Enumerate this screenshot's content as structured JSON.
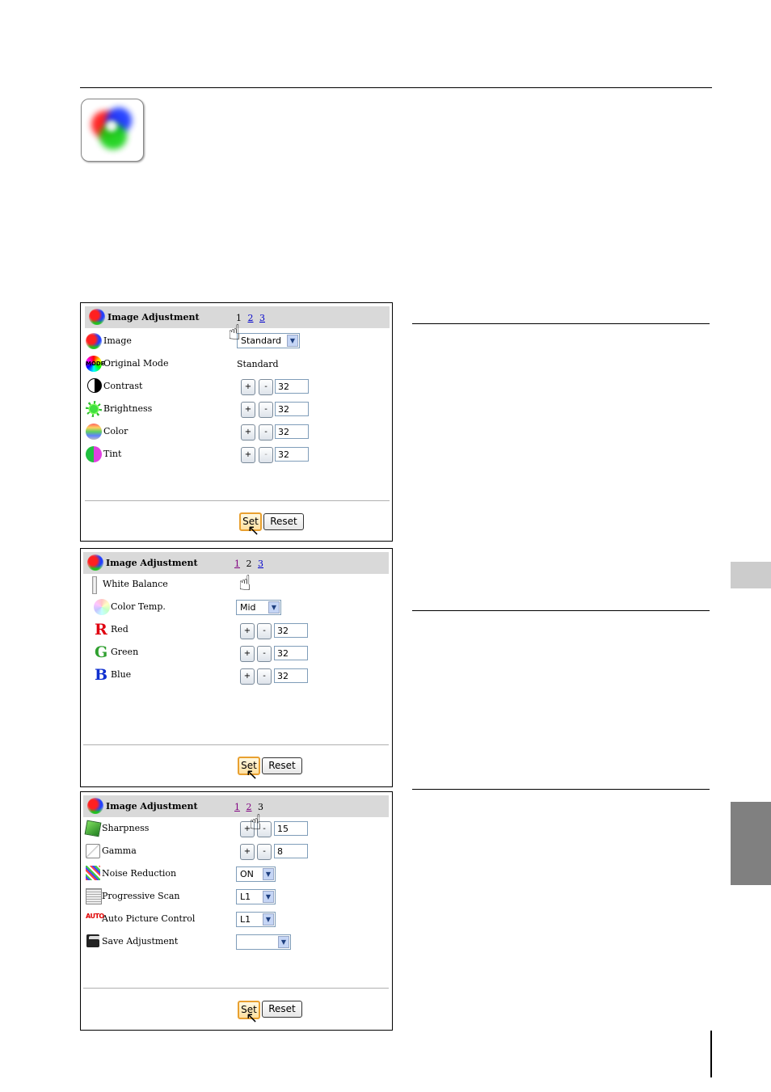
{
  "panels": [
    {
      "title": "Image Adjustment",
      "pages": [
        "1",
        "2",
        "3"
      ],
      "rows": [
        {
          "icon": "image-mode-icon",
          "label": "Image",
          "type": "select",
          "value": "Standard"
        },
        {
          "icon": "mode-icon",
          "label": "Original Mode",
          "type": "text",
          "value": "Standard"
        },
        {
          "icon": "contrast-icon",
          "label": "Contrast",
          "type": "stepper",
          "value": "32"
        },
        {
          "icon": "brightness-icon",
          "label": "Brightness",
          "type": "stepper",
          "value": "32"
        },
        {
          "icon": "color-icon",
          "label": "Color",
          "type": "stepper",
          "value": "32"
        },
        {
          "icon": "tint-icon",
          "label": "Tint",
          "type": "stepper",
          "value": "32"
        }
      ],
      "set_label": "Set",
      "reset_label": "Reset"
    },
    {
      "title": "Image Adjustment",
      "pages": [
        "1",
        "2",
        "3"
      ],
      "rows": [
        {
          "icon": "white-balance-icon",
          "label": "White Balance",
          "type": "none",
          "value": ""
        },
        {
          "icon": "color-temp-icon",
          "label": "Color Temp.",
          "type": "select",
          "value": "Mid"
        },
        {
          "icon": "red-icon",
          "label": "Red",
          "type": "stepper",
          "value": "32"
        },
        {
          "icon": "green-icon",
          "label": "Green",
          "type": "stepper",
          "value": "32"
        },
        {
          "icon": "blue-icon",
          "label": "Blue",
          "type": "stepper",
          "value": "32"
        }
      ],
      "set_label": "Set",
      "reset_label": "Reset"
    },
    {
      "title": "Image Adjustment",
      "pages": [
        "1",
        "2",
        "3"
      ],
      "rows": [
        {
          "icon": "sharpness-icon",
          "label": "Sharpness",
          "type": "stepper",
          "value": "15"
        },
        {
          "icon": "gamma-icon",
          "label": "Gamma",
          "type": "stepper",
          "value": "8"
        },
        {
          "icon": "noise-reduction-icon",
          "label": "Noise Reduction",
          "type": "select",
          "value": "ON"
        },
        {
          "icon": "progressive-scan-icon",
          "label": "Progressive Scan",
          "type": "select",
          "value": "L1"
        },
        {
          "icon": "auto-picture-icon",
          "label": "Auto Picture Control",
          "type": "select",
          "value": "L1"
        },
        {
          "icon": "save-icon",
          "label": "Save Adjustment",
          "type": "select",
          "value": ""
        }
      ],
      "set_label": "Set",
      "reset_label": "Reset"
    }
  ],
  "icon_glyphs": {
    "plus": "+",
    "minus": "-",
    "dropdown": "▼",
    "red_letter": "R",
    "green_letter": "G",
    "blue_letter": "B",
    "mode_text": "MODE",
    "auto_text": "AUTO"
  },
  "colors": {
    "header_bg": "#d9d9d9",
    "side_tab_light": "#cccccc",
    "side_tab_dark": "#808080"
  }
}
